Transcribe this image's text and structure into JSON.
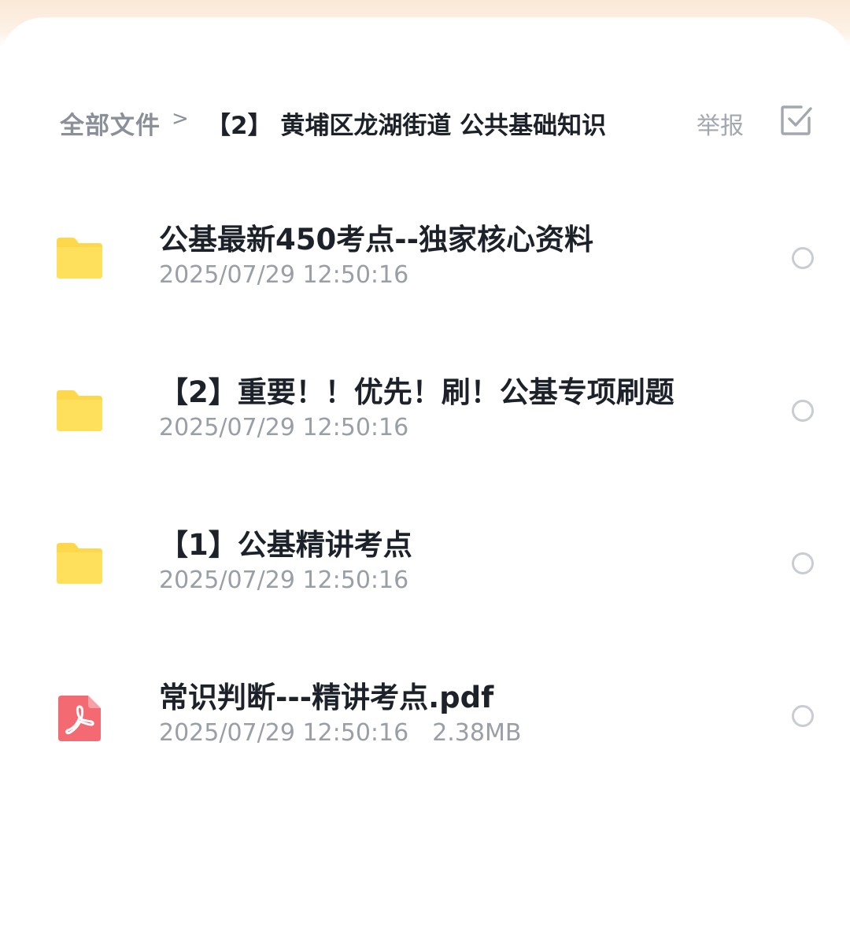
{
  "breadcrumb": {
    "root": "全部文件",
    "separator": ">",
    "current": "【2】 黄埔区龙湖街道 公共基础知识"
  },
  "header": {
    "report_label": "举报",
    "select_icon": "checkbox-check-icon"
  },
  "colors": {
    "folder": "#fdd84a",
    "pdf": "#f46a72",
    "title": "#1d2129",
    "meta": "#9a9ea6"
  },
  "files": [
    {
      "type": "folder",
      "icon": "folder-icon",
      "name": "公基最新450考点--独家核心资料",
      "modified": "2025/07/29 12:50:16",
      "size": ""
    },
    {
      "type": "folder",
      "icon": "folder-icon",
      "name": "【2】重要！！优先！刷！公基专项刷题",
      "modified": "2025/07/29 12:50:16",
      "size": ""
    },
    {
      "type": "folder",
      "icon": "folder-icon",
      "name": "【1】公基精讲考点",
      "modified": "2025/07/29 12:50:16",
      "size": ""
    },
    {
      "type": "pdf",
      "icon": "pdf-file-icon",
      "name": "常识判断---精讲考点.pdf",
      "modified": "2025/07/29 12:50:16",
      "size": "2.38MB"
    }
  ]
}
